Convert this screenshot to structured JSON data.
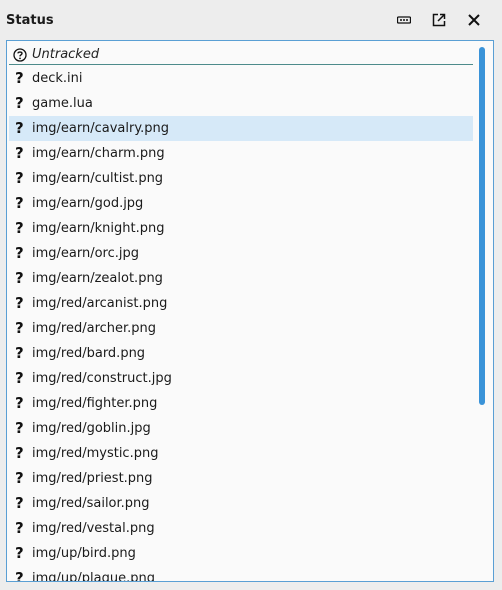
{
  "panel": {
    "title": "Status"
  },
  "toolbar": {
    "more_icon": "more-horizontal-icon",
    "popout_icon": "external-link-icon",
    "close_icon": "close-icon"
  },
  "group": {
    "label": "Untracked",
    "icon": "question-circle-icon"
  },
  "files": [
    {
      "name": "deck.ini",
      "selected": false
    },
    {
      "name": "game.lua",
      "selected": false
    },
    {
      "name": "img/earn/cavalry.png",
      "selected": true
    },
    {
      "name": "img/earn/charm.png",
      "selected": false
    },
    {
      "name": "img/earn/cultist.png",
      "selected": false
    },
    {
      "name": "img/earn/god.jpg",
      "selected": false
    },
    {
      "name": "img/earn/knight.png",
      "selected": false
    },
    {
      "name": "img/earn/orc.jpg",
      "selected": false
    },
    {
      "name": "img/earn/zealot.png",
      "selected": false
    },
    {
      "name": "img/red/arcanist.png",
      "selected": false
    },
    {
      "name": "img/red/archer.png",
      "selected": false
    },
    {
      "name": "img/red/bard.png",
      "selected": false
    },
    {
      "name": "img/red/construct.jpg",
      "selected": false
    },
    {
      "name": "img/red/fighter.png",
      "selected": false
    },
    {
      "name": "img/red/goblin.jpg",
      "selected": false
    },
    {
      "name": "img/red/mystic.png",
      "selected": false
    },
    {
      "name": "img/red/priest.png",
      "selected": false
    },
    {
      "name": "img/red/sailor.png",
      "selected": false
    },
    {
      "name": "img/red/vestal.png",
      "selected": false
    },
    {
      "name": "img/up/bird.png",
      "selected": false
    },
    {
      "name": "img/up/plague.png",
      "selected": false
    }
  ],
  "colors": {
    "accent": "#3a93d8",
    "selection": "#d6e9f8",
    "header_rule": "#4d8b8b"
  }
}
